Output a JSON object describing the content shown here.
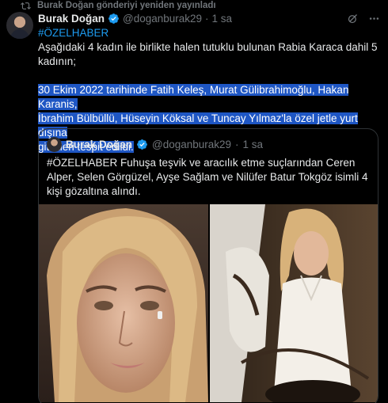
{
  "repost": {
    "text": "Burak Doğan gönderiyi yeniden yayınladı",
    "icon": "repost-icon"
  },
  "tweet": {
    "author_name": "Burak Doğan",
    "handle": "@doganburak29",
    "separator": "·",
    "time": "1 sa",
    "hashtag": "#ÖZELHABER",
    "paragraph1": "Aşağıdaki 4 kadın ile birlikte halen tutuklu bulunan Rabia Karaca dahil 5 kadının;",
    "paragraph2_line1": "30 Ekim 2022 tarihinde Fatih Keleş, Murat Gülibrahimoğlu, Hakan Karanis,",
    "paragraph2_line2": "İbrahim Bülbüllü, Hüseyin Köksal ve Tuncay Yılmaz'la özel jetle yurt dışına",
    "paragraph2_line3": "gittikleri tespit edildi.",
    "verified_icon": "verified-badge-icon",
    "grok_icon": "grok-icon",
    "more_icon": "more-icon"
  },
  "quote": {
    "author_name": "Burak Doğan",
    "handle": "@doganburak29",
    "separator": "·",
    "time": "1 sa",
    "text": "#ÖZELHABER Fuhuşa teşvik ve aracılık etme suçlarından Ceren Alper, Selen Görgüzel, Ayşe Sağlam ve Nilüfer Batur Tokgöz isimli 4 kişi gözaltına alındı."
  },
  "colors": {
    "background": "#000000",
    "text": "#e7e9ea",
    "muted": "#71767b",
    "accent": "#1d9bf0",
    "selection": "#1e56c4",
    "border": "#2f3336"
  }
}
